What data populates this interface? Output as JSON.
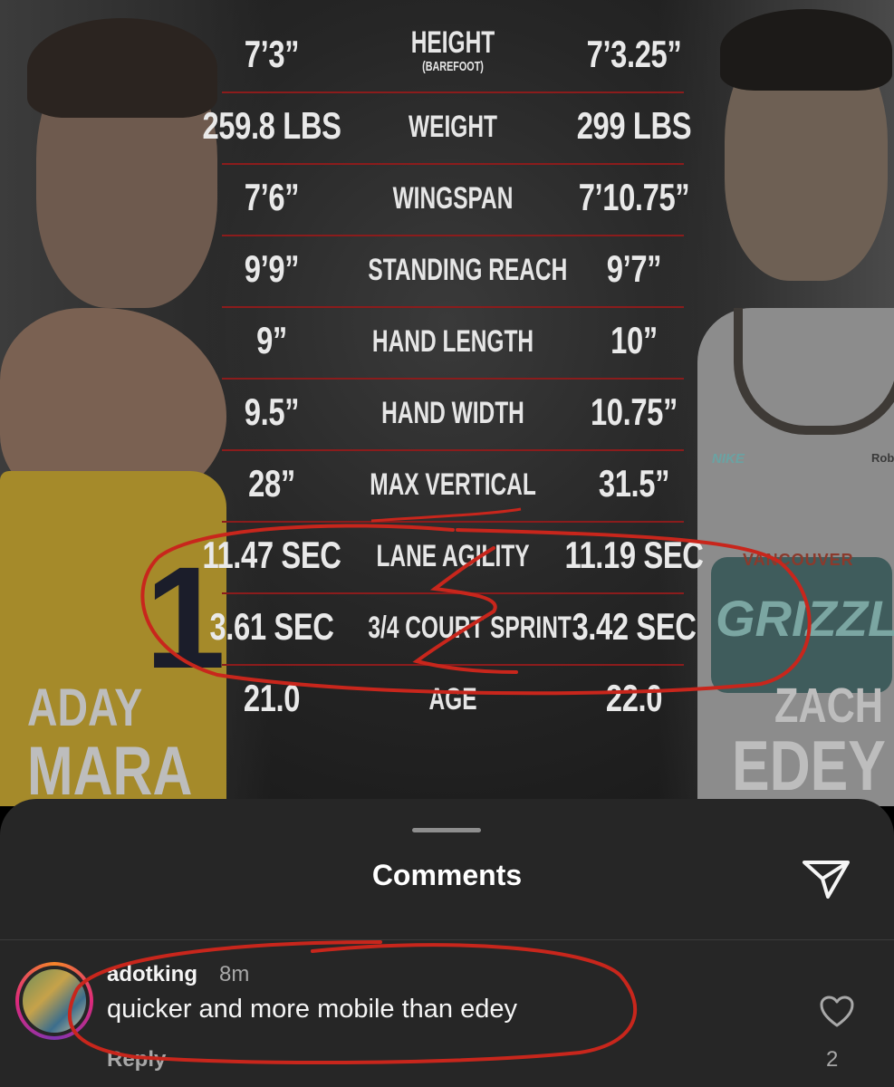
{
  "stats": {
    "rows": [
      {
        "left": "7’3”",
        "label": "HEIGHT",
        "sublabel": "(BAREFOOT)",
        "right": "7’3.25”"
      },
      {
        "left": "259.8 LBS",
        "label": "WEIGHT",
        "right": "299 LBS"
      },
      {
        "left": "7’6”",
        "label": "WINGSPAN",
        "right": "7’10.75”"
      },
      {
        "left": "9’9”",
        "label": "STANDING REACH",
        "right": "9’7”"
      },
      {
        "left": "9”",
        "label": "HAND LENGTH",
        "right": "10”"
      },
      {
        "left": "9.5”",
        "label": "HAND WIDTH",
        "right": "10.75”"
      },
      {
        "left": "28”",
        "label": "MAX VERTICAL",
        "right": "31.5”"
      },
      {
        "left": "11.47 SEC",
        "label": "LANE AGILITY",
        "right": "11.19 SEC"
      },
      {
        "left": "3.61 SEC",
        "label": "3/4 COURT SPRINT",
        "right": "3.42 SEC"
      },
      {
        "left": "21.0",
        "label": "AGE",
        "right": "22.0"
      }
    ]
  },
  "players": {
    "left": {
      "first": "ADAY",
      "last": "MARA",
      "number": "1"
    },
    "right": {
      "first": "ZACH",
      "last": "EDEY"
    }
  },
  "jersey": {
    "team_top": "VANCOUVER",
    "team_big": "GRIZZLI",
    "brand": "NIKE",
    "sponsor": "Rob"
  },
  "comments_sheet": {
    "title": "Comments",
    "comment": {
      "username": "adotking",
      "time": "8m",
      "text": "quicker and more mobile than edey",
      "reply_label": "Reply",
      "like_count": "2"
    }
  },
  "colors": {
    "sheet_bg": "#262626",
    "annotation_red": "#c8261c",
    "divider_red": "#8b1c1c"
  },
  "icons": {
    "share": "paper-plane-icon",
    "like": "heart-outline-icon"
  }
}
